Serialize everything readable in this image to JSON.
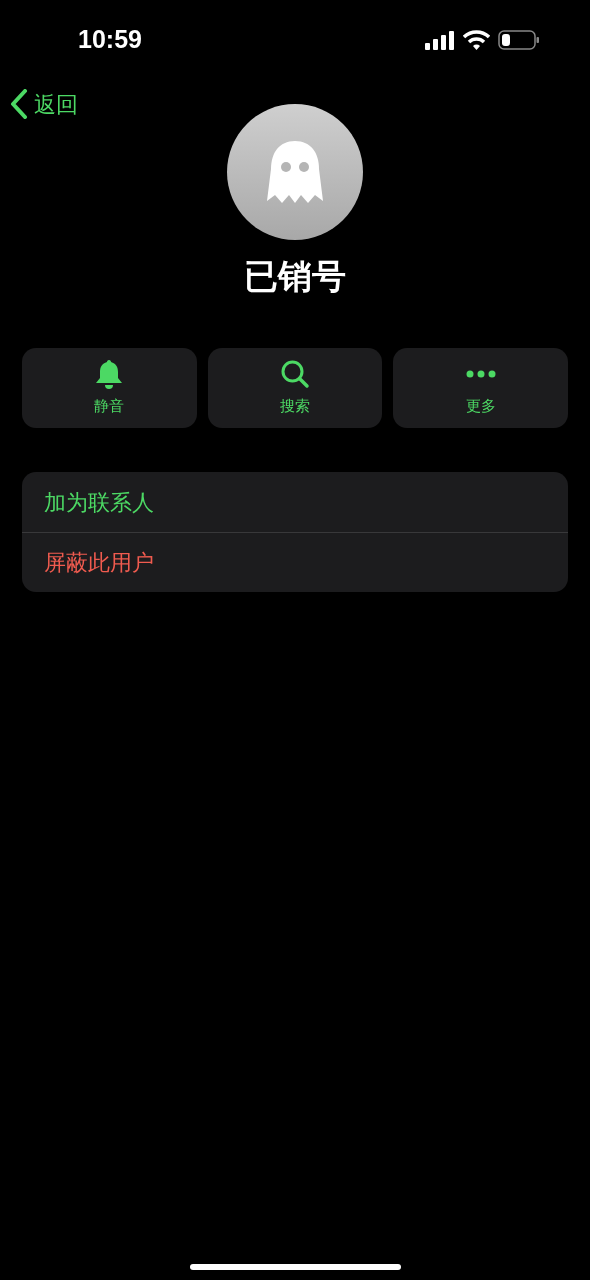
{
  "status_bar": {
    "time": "10:59"
  },
  "nav": {
    "back": "返回"
  },
  "profile": {
    "name": "已销号"
  },
  "actions": [
    {
      "kind": "mute",
      "label": "静音"
    },
    {
      "kind": "search",
      "label": "搜索"
    },
    {
      "kind": "more",
      "label": "更多"
    }
  ],
  "options": [
    {
      "kind": "normal",
      "label": "加为联系人"
    },
    {
      "kind": "destructive",
      "label": "屏蔽此用户"
    }
  ]
}
